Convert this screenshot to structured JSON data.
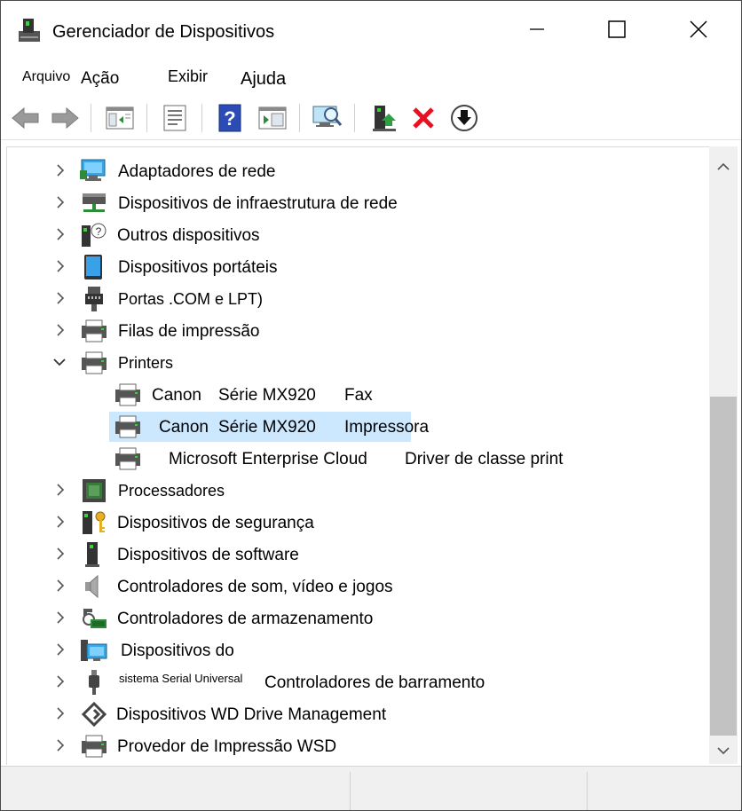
{
  "window": {
    "title": "Gerenciador de Dispositivos",
    "app_icon": "device-manager-icon"
  },
  "menu": {
    "file": "Arquivo",
    "action": "Ação",
    "view": "Exibir",
    "help": "Ajuda"
  },
  "toolbar": {
    "icons": [
      "back-arrow-icon",
      "forward-arrow-icon",
      "properties-view-icon",
      "properties-sheet-icon",
      "help-icon",
      "console-tree-icon",
      "scan-hardware-icon",
      "update-driver-icon",
      "uninstall-device-icon",
      "enable-device-icon"
    ]
  },
  "tree": {
    "categories": [
      {
        "label": "Adaptadores de rede"
      },
      {
        "label": "Dispositivos de infraestrutura de rede"
      },
      {
        "label": "Outros dispositivos"
      },
      {
        "label": "Dispositivos portáteis"
      },
      {
        "label": "Portas .COM e LPT)"
      },
      {
        "label": "Filas de impressão"
      },
      {
        "label": "Printers"
      }
    ],
    "printers": [
      {
        "part1": "Canon",
        "part2": "Série MX920",
        "part3": "Fax"
      },
      {
        "part1": "Canon",
        "part2": "Série MX920",
        "part3": "Impressora"
      },
      {
        "part1": "Microsoft Enterprise Cloud",
        "part2": "Driver de classe print"
      }
    ],
    "more_categories": [
      {
        "label": "Processadores"
      },
      {
        "label": "Dispositivos de segurança"
      },
      {
        "label": "Dispositivos de software"
      },
      {
        "label": "Controladores de som, vídeo e jogos"
      },
      {
        "label": "Controladores de armazenamento"
      },
      {
        "label": "Dispositivos do"
      },
      {
        "small": "sistema Serial Universal",
        "label": "Controladores de barramento"
      },
      {
        "label": "Dispositivos WD Drive Management"
      },
      {
        "label": "Provedor de Impressão WSD"
      }
    ]
  },
  "colors": {
    "selection": "#cce8ff",
    "scrollbar_thumb": "#c2c2c2",
    "uninstall_red": "#e81123",
    "help_blue": "#2b4bb5"
  }
}
